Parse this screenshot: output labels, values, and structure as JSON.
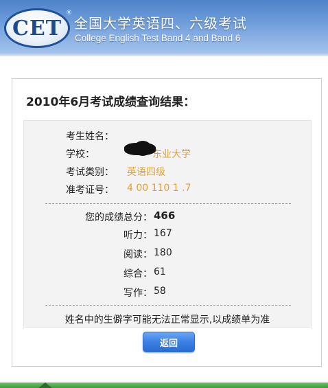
{
  "header": {
    "logo_text": "CET",
    "reg_mark": "®",
    "title_cn": "全国大学英语四、六级考试",
    "title_en": "College English Test Band 4 and Band 6"
  },
  "result": {
    "title": "2010年6月考试成绩查询结果：",
    "fields": [
      {
        "label": "考生姓名：",
        "value": ""
      },
      {
        "label": "学校：",
        "value": "东业大学"
      },
      {
        "label": "考试类别：",
        "value": "英语四级"
      },
      {
        "label": "准考证号：",
        "value": "4 00 110 1 .7"
      }
    ],
    "scores": [
      {
        "label": "您的成绩总分：",
        "value": "466"
      },
      {
        "label": "听力：",
        "value": "167"
      },
      {
        "label": "阅读：",
        "value": "180"
      },
      {
        "label": "综合：",
        "value": "61"
      },
      {
        "label": "写作：",
        "value": "58"
      }
    ],
    "note": "姓名中的生僻字可能无法正常显示,以成绩单为准"
  },
  "buttons": {
    "back": "返回"
  }
}
